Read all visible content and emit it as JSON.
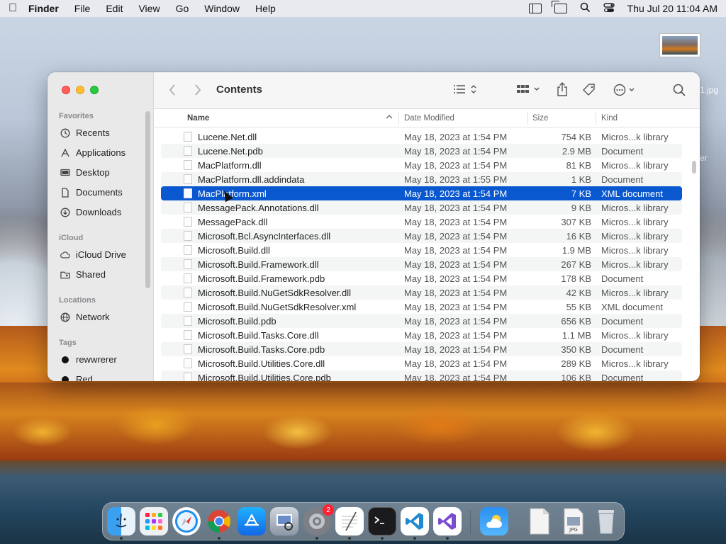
{
  "menubar": {
    "app_name": "Finder",
    "items": [
      "File",
      "Edit",
      "View",
      "Go",
      "Window",
      "Help"
    ],
    "datetime": "Thu Jul 20  11:04 AM"
  },
  "desktop": {
    "file_label_1": "1.jpg",
    "file_label_2": "er"
  },
  "window": {
    "title": "Contents",
    "sidebar": {
      "favorites_title": "Favorites",
      "favorites": [
        "Recents",
        "Applications",
        "Desktop",
        "Documents",
        "Downloads"
      ],
      "icloud_title": "iCloud",
      "icloud": [
        "iCloud Drive",
        "Shared"
      ],
      "locations_title": "Locations",
      "locations": [
        "Network"
      ],
      "tags_title": "Tags",
      "tags": [
        "rewwrerer",
        "Red"
      ]
    },
    "columns": {
      "name": "Name",
      "date": "Date Modified",
      "size": "Size",
      "kind": "Kind"
    },
    "files": [
      {
        "name": "Lucene.Net.dll",
        "date": "May 18, 2023 at 1:54 PM",
        "size": "754 KB",
        "kind": "Micros...k library"
      },
      {
        "name": "Lucene.Net.pdb",
        "date": "May 18, 2023 at 1:54 PM",
        "size": "2.9 MB",
        "kind": "Document"
      },
      {
        "name": "MacPlatform.dll",
        "date": "May 18, 2023 at 1:54 PM",
        "size": "81 KB",
        "kind": "Micros...k library"
      },
      {
        "name": "MacPlatform.dll.addindata",
        "date": "May 18, 2023 at 1:55 PM",
        "size": "1 KB",
        "kind": "Document"
      },
      {
        "name": "MacPlatform.xml",
        "date": "May 18, 2023 at 1:54 PM",
        "size": "7 KB",
        "kind": "XML document",
        "selected": true
      },
      {
        "name": "MessagePack.Annotations.dll",
        "date": "May 18, 2023 at 1:54 PM",
        "size": "9 KB",
        "kind": "Micros...k library"
      },
      {
        "name": "MessagePack.dll",
        "date": "May 18, 2023 at 1:54 PM",
        "size": "307 KB",
        "kind": "Micros...k library"
      },
      {
        "name": "Microsoft.Bcl.AsyncInterfaces.dll",
        "date": "May 18, 2023 at 1:54 PM",
        "size": "16 KB",
        "kind": "Micros...k library"
      },
      {
        "name": "Microsoft.Build.dll",
        "date": "May 18, 2023 at 1:54 PM",
        "size": "1.9 MB",
        "kind": "Micros...k library"
      },
      {
        "name": "Microsoft.Build.Framework.dll",
        "date": "May 18, 2023 at 1:54 PM",
        "size": "267 KB",
        "kind": "Micros...k library"
      },
      {
        "name": "Microsoft.Build.Framework.pdb",
        "date": "May 18, 2023 at 1:54 PM",
        "size": "178 KB",
        "kind": "Document"
      },
      {
        "name": "Microsoft.Build.NuGetSdkResolver.dll",
        "date": "May 18, 2023 at 1:54 PM",
        "size": "42 KB",
        "kind": "Micros...k library"
      },
      {
        "name": "Microsoft.Build.NuGetSdkResolver.xml",
        "date": "May 18, 2023 at 1:54 PM",
        "size": "55 KB",
        "kind": "XML document"
      },
      {
        "name": "Microsoft.Build.pdb",
        "date": "May 18, 2023 at 1:54 PM",
        "size": "656 KB",
        "kind": "Document"
      },
      {
        "name": "Microsoft.Build.Tasks.Core.dll",
        "date": "May 18, 2023 at 1:54 PM",
        "size": "1.1 MB",
        "kind": "Micros...k library"
      },
      {
        "name": "Microsoft.Build.Tasks.Core.pdb",
        "date": "May 18, 2023 at 1:54 PM",
        "size": "350 KB",
        "kind": "Document"
      },
      {
        "name": "Microsoft.Build.Utilities.Core.dll",
        "date": "May 18, 2023 at 1:54 PM",
        "size": "289 KB",
        "kind": "Micros...k library"
      },
      {
        "name": "Microsoft.Build.Utilities.Core.pdb",
        "date": "May 18, 2023 at 1:54 PM",
        "size": "106 KB",
        "kind": "Document"
      }
    ]
  },
  "dock": {
    "apps": [
      "finder-icon",
      "launchpad-icon",
      "safari-icon",
      "chrome-icon",
      "app-store-icon",
      "preview-icon",
      "system-settings-icon",
      "textedit-icon",
      "terminal-icon",
      "vscode-icon",
      "visual-studio-icon",
      "weather-icon",
      "document-icon",
      "jpg-file-icon",
      "trash-icon"
    ],
    "settings_badge": "2",
    "jpg_label": "JPG"
  },
  "colors": {
    "selection": "#0a58d0",
    "close": "#ff5f57",
    "minimize": "#febc2e",
    "zoom": "#28c840"
  }
}
